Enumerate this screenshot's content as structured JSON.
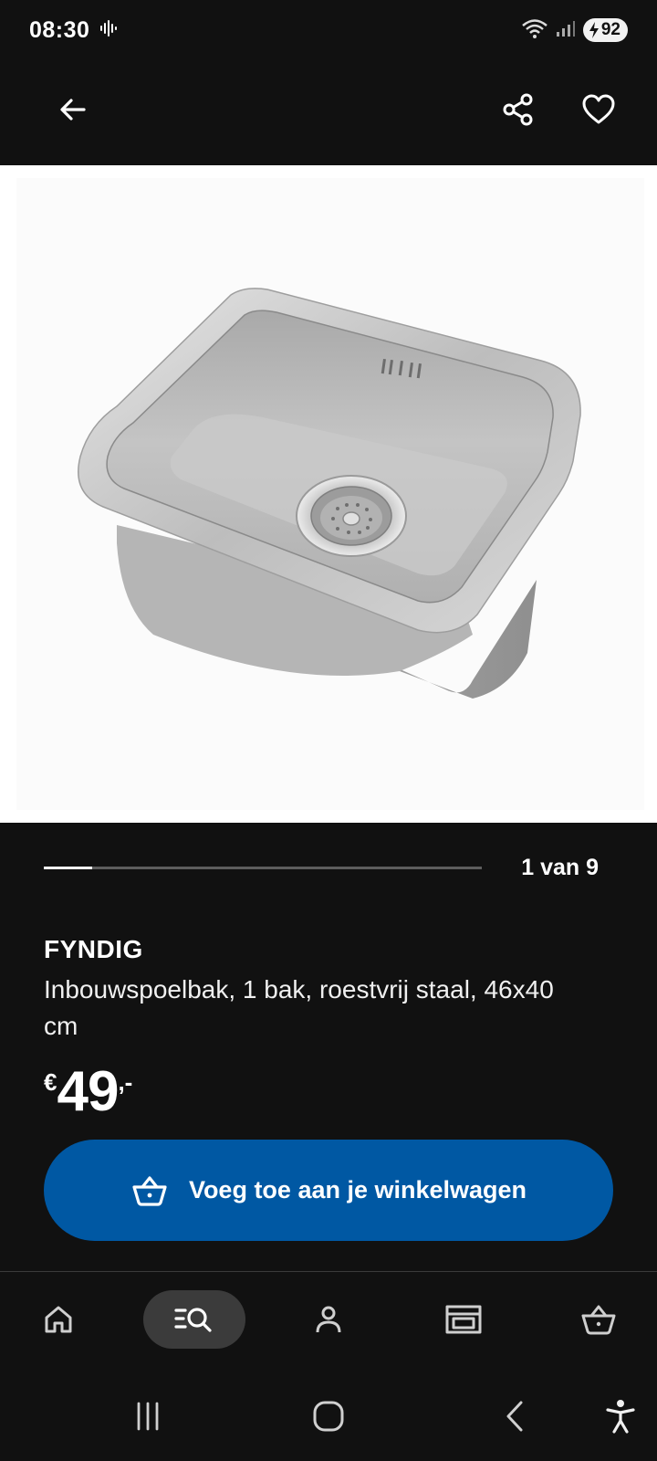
{
  "status": {
    "time": "08:30",
    "battery": "92"
  },
  "carousel": {
    "indicator_text": "1 van 9",
    "current": 1,
    "total": 9
  },
  "product": {
    "name": "FYNDIG",
    "description": "Inbouwspoelbak, 1 bak, roestvrij staal, 46x40 cm",
    "price": {
      "currency": "€",
      "amount": "49",
      "decimals": ",-"
    }
  },
  "actions": {
    "add_to_cart_label": "Voeg toe aan je winkelwagen"
  },
  "colors": {
    "background": "#111111",
    "primary_button": "#0058a3",
    "nav_active_pill": "#3b3b3b"
  },
  "icons": {
    "back": "arrow-left-icon",
    "share": "share-icon",
    "favorite": "heart-icon",
    "cart": "shopping-basket-icon",
    "home": "home-icon",
    "search": "search-list-icon",
    "profile": "person-icon",
    "stores": "store-icon",
    "recents": "recents-icon",
    "system_home": "system-home-icon",
    "system_back": "system-back-icon",
    "accessibility": "accessibility-icon"
  }
}
